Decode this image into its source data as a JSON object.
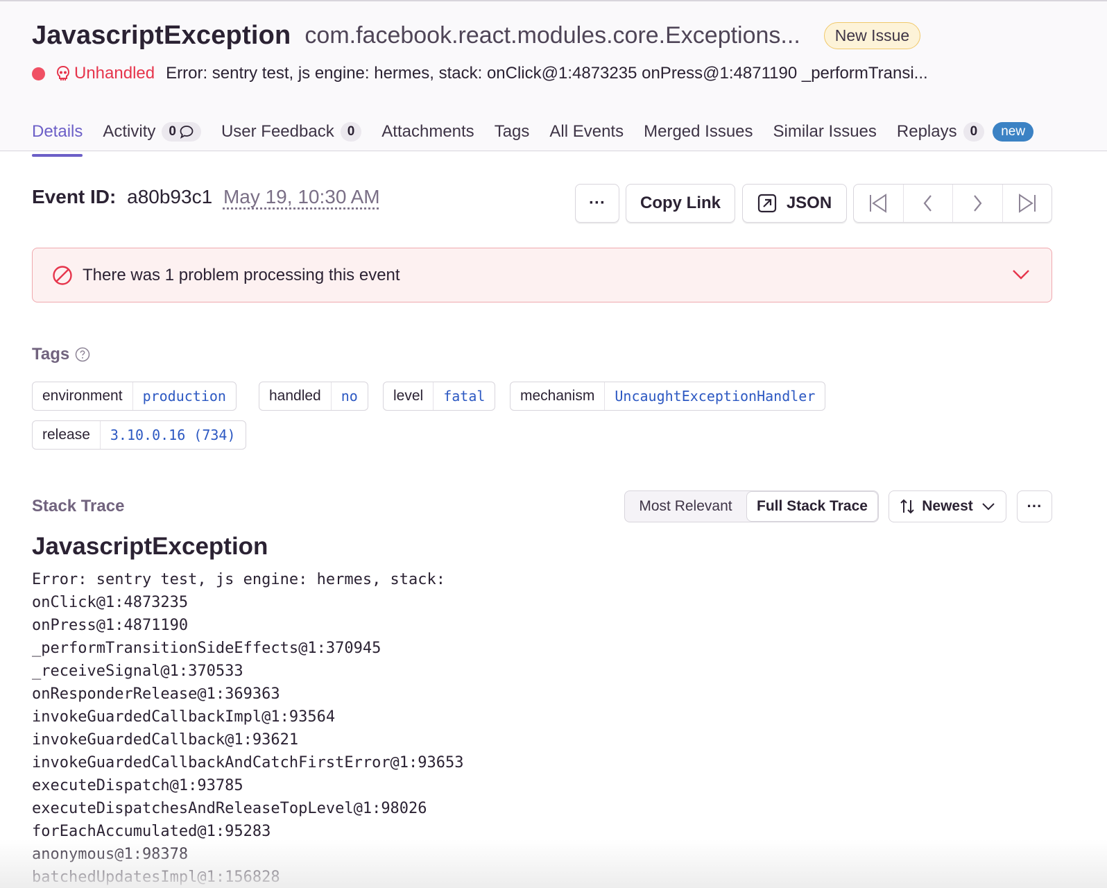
{
  "issue": {
    "title": "JavascriptException",
    "subtitle": "com.facebook.react.modules.core.Exceptions...",
    "status_badge": "New Issue",
    "level_dot_color": "#f05064",
    "unhandled_label": "Unhandled",
    "message": "Error: sentry test, js engine: hermes, stack: onClick@1:4873235 onPress@1:4871190 _performTransi..."
  },
  "tabs": [
    {
      "label": "Details",
      "active": true
    },
    {
      "label": "Activity",
      "count": "0",
      "icon": "chat-bubble-icon"
    },
    {
      "label": "User Feedback",
      "count": "0"
    },
    {
      "label": "Attachments"
    },
    {
      "label": "Tags"
    },
    {
      "label": "All Events"
    },
    {
      "label": "Merged Issues"
    },
    {
      "label": "Similar Issues"
    },
    {
      "label": "Replays",
      "count": "0",
      "badge": "new"
    }
  ],
  "event": {
    "label": "Event ID:",
    "id": "a80b93c1",
    "date": "May 19, 10:30 AM"
  },
  "toolbar": {
    "more_label": "···",
    "copy_link_label": "Copy Link",
    "json_label": "JSON"
  },
  "alert": {
    "text": "There was 1 problem processing this event"
  },
  "tags_section": {
    "title": "Tags",
    "items": [
      {
        "key": "environment",
        "value": "production"
      },
      {
        "key": "handled",
        "value": "no"
      },
      {
        "key": "level",
        "value": "fatal"
      },
      {
        "key": "mechanism",
        "value": "UncaughtExceptionHandler"
      },
      {
        "key": "release",
        "value": "3.10.0.16 (734)"
      }
    ]
  },
  "stack_trace": {
    "title": "Stack Trace",
    "toggle_options": [
      "Most Relevant",
      "Full Stack Trace"
    ],
    "selected_toggle": "Full Stack Trace",
    "sort_label": "Newest",
    "more_label": "···",
    "exception_type": "JavascriptException",
    "exception_lines": [
      "Error: sentry test, js engine: hermes, stack:",
      "onClick@1:4873235",
      "onPress@1:4871190",
      "_performTransitionSideEffects@1:370945",
      "_receiveSignal@1:370533",
      "onResponderRelease@1:369363",
      "invokeGuardedCallbackImpl@1:93564",
      "invokeGuardedCallback@1:93621",
      "invokeGuardedCallbackAndCatchFirstError@1:93653",
      "executeDispatch@1:93785",
      "executeDispatchesAndReleaseTopLevel@1:98026",
      "forEachAccumulated@1:95283",
      "anonymous@1:98378",
      "batchedUpdatesImpl@1:156828"
    ]
  },
  "colors": {
    "accent": "#6c5fc7",
    "error": "#e6354c",
    "link": "#2c58c2"
  }
}
